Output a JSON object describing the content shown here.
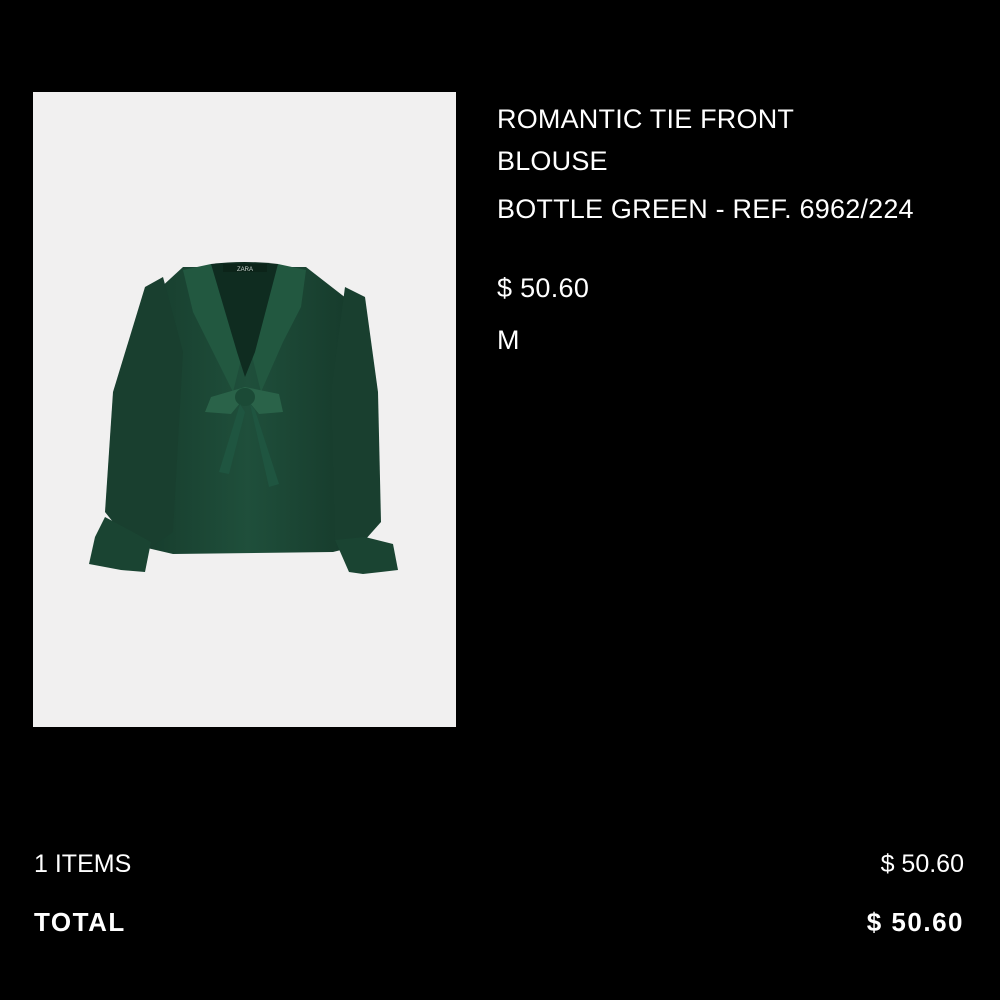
{
  "product": {
    "name": "ROMANTIC TIE FRONT BLOUSE",
    "color_ref": "BOTTLE GREEN - REF. 6962/224",
    "price": "$ 50.60",
    "size": "M",
    "image_label": "ZARA"
  },
  "summary": {
    "items_label": "1 ITEMS",
    "items_price": "$ 50.60",
    "total_label": "TOTAL",
    "total_price": "$ 50.60"
  },
  "colors": {
    "background": "#000000",
    "text": "#ffffff",
    "image_background": "#f1f0f0",
    "garment": "#1d4a37"
  }
}
